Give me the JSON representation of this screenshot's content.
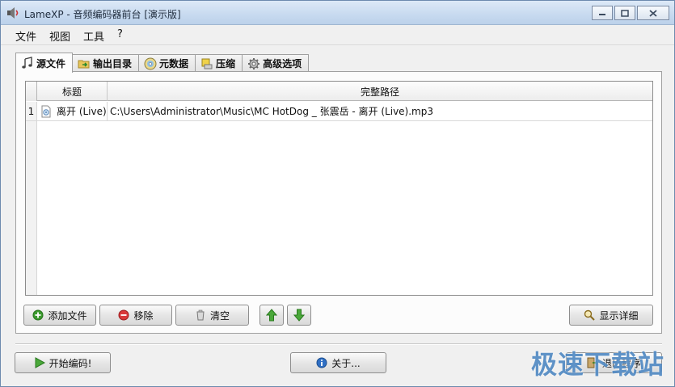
{
  "window": {
    "title": "LameXP - 音频编码器前台 [演示版]"
  },
  "menu": [
    "文件",
    "视图",
    "工具",
    "?"
  ],
  "tabs": [
    {
      "label": "源文件",
      "icon": "music-note-icon",
      "active": true
    },
    {
      "label": "输出目录",
      "icon": "folder-arrow-icon",
      "active": false
    },
    {
      "label": "元数据",
      "icon": "cd-icon",
      "active": false
    },
    {
      "label": "压缩",
      "icon": "compress-icon",
      "active": false
    },
    {
      "label": "高级选项",
      "icon": "gear-icon",
      "active": false
    }
  ],
  "table": {
    "headers": [
      "标题",
      "完整路径"
    ],
    "rows": [
      {
        "num": "1",
        "title": "离开 (Live)",
        "path": "C:\\Users\\Administrator\\Music\\MC HotDog _ 张震岳 - 离开 (Live).mp3"
      }
    ]
  },
  "buttons": {
    "add_file": "添加文件",
    "remove": "移除",
    "clear": "清空",
    "show_details": "显示详细",
    "start_encoding": "开始编码!",
    "about": "关于...",
    "exit": "退出程序"
  },
  "watermark": "极速下载站",
  "colors": {
    "accent_green": "#3c9b2f",
    "remove_red": "#d9383a",
    "info_blue": "#2f6fc4"
  }
}
